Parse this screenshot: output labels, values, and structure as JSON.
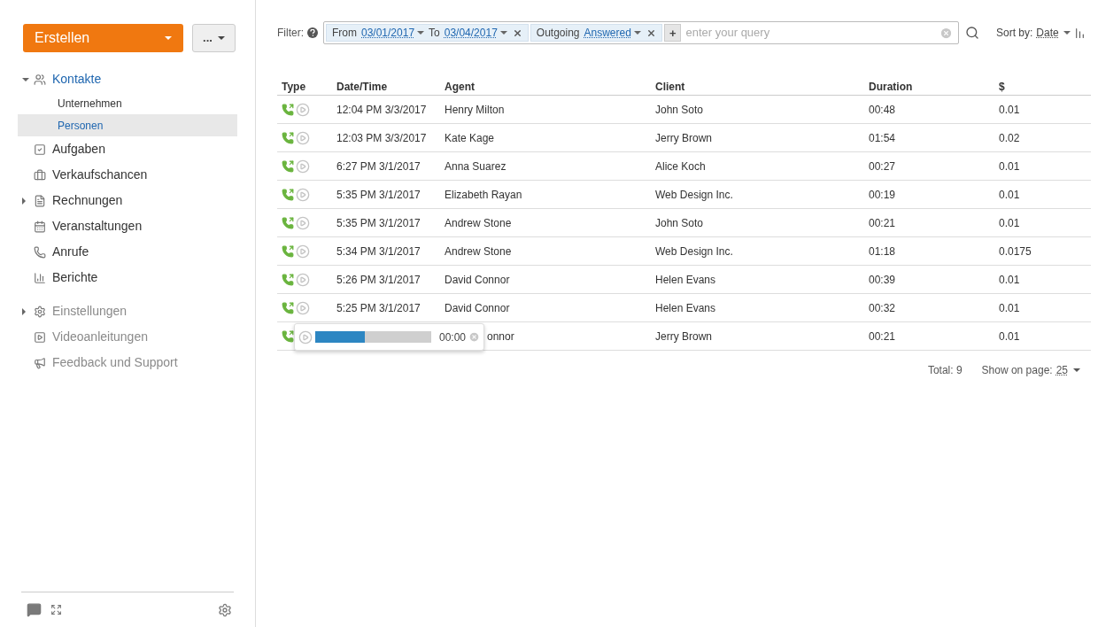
{
  "create_button": {
    "label": "Erstellen"
  },
  "more_button": {
    "label": "..."
  },
  "sidebar": {
    "items": [
      {
        "label": "Kontakte",
        "kind": "main",
        "active": true,
        "expanded": true,
        "children": [
          {
            "label": "Unternehmen",
            "selected": false
          },
          {
            "label": "Personen",
            "selected": true
          }
        ]
      },
      {
        "label": "Aufgaben",
        "kind": "main",
        "active": false
      },
      {
        "label": "Verkaufschancen",
        "kind": "main",
        "active": false
      },
      {
        "label": "Rechnungen",
        "kind": "main",
        "active": false,
        "expanded": false
      },
      {
        "label": "Veranstaltungen",
        "kind": "main",
        "active": false
      },
      {
        "label": "Anrufe",
        "kind": "main",
        "active": false
      },
      {
        "label": "Berichte",
        "kind": "main",
        "active": false
      },
      {
        "label": "Einstellungen",
        "kind": "extra",
        "active": false,
        "expanded": false
      },
      {
        "label": "Videoanleitungen",
        "kind": "extra",
        "active": false
      },
      {
        "label": "Feedback und Support",
        "kind": "extra",
        "active": false
      }
    ]
  },
  "filter": {
    "label": "Filter:",
    "chips": [
      {
        "parts": [
          {
            "text": "From"
          },
          {
            "text": "03/01/2017",
            "dropdown": true
          },
          {
            "text": "To"
          },
          {
            "text": "03/04/2017",
            "dropdown": true
          }
        ]
      },
      {
        "parts": [
          {
            "text": "Outgoing"
          },
          {
            "text": "Answered",
            "dropdown": true
          }
        ]
      }
    ],
    "add_label": "+",
    "placeholder": "enter your query"
  },
  "sort": {
    "label": "Sort by:",
    "value": "Date"
  },
  "table": {
    "columns": [
      "Type",
      "Date/Time",
      "Agent",
      "Client",
      "Duration",
      "$"
    ],
    "rows": [
      {
        "datetime": "12:04 PM 3/3/2017",
        "agent": "Henry Milton",
        "client": "John Soto",
        "duration": "00:48",
        "cost": "0.01"
      },
      {
        "datetime": "12:03 PM 3/3/2017",
        "agent": "Kate Kage",
        "client": "Jerry Brown",
        "duration": "01:54",
        "cost": "0.02"
      },
      {
        "datetime": "6:27 PM 3/1/2017",
        "agent": "Anna Suarez",
        "client": "Alice Koch",
        "duration": "00:27",
        "cost": "0.01"
      },
      {
        "datetime": "5:35 PM 3/1/2017",
        "agent": "Elizabeth Rayan",
        "client": "Web Design Inc.",
        "duration": "00:19",
        "cost": "0.01"
      },
      {
        "datetime": "5:35 PM 3/1/2017",
        "agent": "Andrew Stone",
        "client": "John Soto",
        "duration": "00:21",
        "cost": "0.01"
      },
      {
        "datetime": "5:34 PM 3/1/2017",
        "agent": "Andrew Stone",
        "client": "Web Design Inc.",
        "duration": "01:18",
        "cost": "0.0175"
      },
      {
        "datetime": "5:26 PM 3/1/2017",
        "agent": "David Connor",
        "client": "Helen Evans",
        "duration": "00:39",
        "cost": "0.01"
      },
      {
        "datetime": "5:25 PM 3/1/2017",
        "agent": "David Connor",
        "client": "Helen Evans",
        "duration": "00:32",
        "cost": "0.01"
      },
      {
        "agent": "onnor",
        "client": "Jerry Brown",
        "duration": "00:21",
        "cost": "0.01",
        "player": {
          "level": 0.43,
          "time": "00:00"
        }
      }
    ]
  },
  "footer": {
    "total": "Total: 9",
    "page_size_label": "Show on page:",
    "page_size": "25"
  }
}
